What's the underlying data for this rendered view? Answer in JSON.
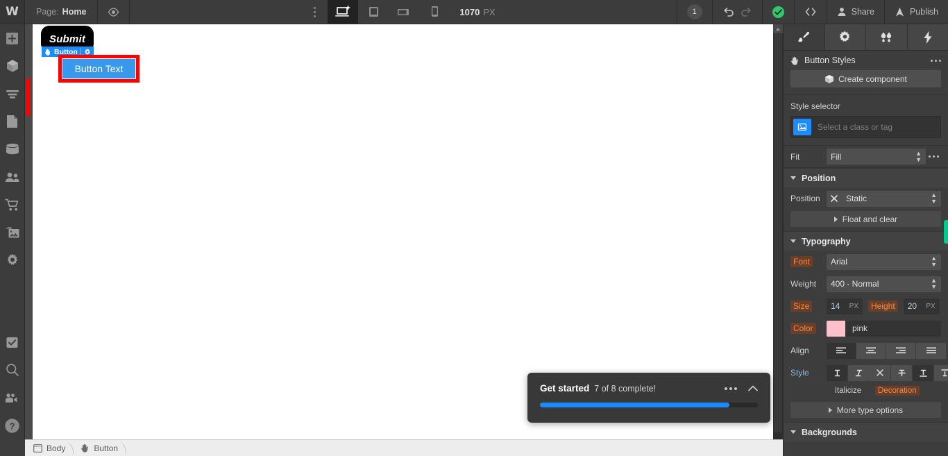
{
  "topbar": {
    "logo": "W",
    "page_label": "Page:",
    "page_name": "Home",
    "preview_icon": "eye-icon",
    "more_icon": "vertical-dots-icon",
    "breakpoints": [
      {
        "name": "desktop",
        "icon": "desktop-breakpoint-icon",
        "active": true
      },
      {
        "name": "tablet",
        "icon": "tablet-breakpoint-icon",
        "active": false
      },
      {
        "name": "mobile-landscape",
        "icon": "mobile-landscape-breakpoint-icon",
        "active": false
      },
      {
        "name": "mobile-portrait",
        "icon": "mobile-portrait-breakpoint-icon",
        "active": false
      }
    ],
    "viewport_width": "1070",
    "viewport_unit": "PX",
    "changes_count": "1",
    "undo_icon": "undo-icon",
    "redo_icon": "redo-icon",
    "saved_icon": "checkmark-icon",
    "code_icon": "code-brackets-icon",
    "share_label": "Share",
    "publish_label": "Publish"
  },
  "left_rail": {
    "items": [
      {
        "icon": "add-elements-icon",
        "name": "add-panel"
      },
      {
        "icon": "components-icon",
        "name": "components-panel"
      },
      {
        "icon": "navigator-icon",
        "name": "navigator-panel"
      },
      {
        "icon": "pages-icon",
        "name": "pages-panel"
      },
      {
        "icon": "cms-database-icon",
        "name": "cms-panel"
      },
      {
        "icon": "users-icon",
        "name": "users-panel"
      },
      {
        "icon": "ecommerce-cart-icon",
        "name": "ecommerce-panel"
      },
      {
        "icon": "assets-images-icon",
        "name": "assets-panel"
      },
      {
        "icon": "settings-gear-icon",
        "name": "settings-panel"
      }
    ],
    "bottom_items": [
      {
        "icon": "audit-checkbox-icon",
        "name": "audit-panel"
      },
      {
        "icon": "search-icon",
        "name": "search-panel"
      },
      {
        "icon": "video-camera-icon",
        "name": "video-tutorials"
      },
      {
        "icon": "help-question-icon",
        "name": "help-button"
      }
    ]
  },
  "canvas": {
    "submit_button_text": "Submit",
    "selected_label": "Button",
    "selected_label_hand_icon": "hand-cursor-icon",
    "selected_label_gear_icon": "gear-icon",
    "selected_button_text": "Button Text"
  },
  "get_started": {
    "title": "Get started",
    "subtitle": "7 of 8 complete!",
    "progress_percent": 87,
    "more_icon": "horizontal-dots-icon",
    "collapse_icon": "chevron-up-icon",
    "accent": "#1a8cff"
  },
  "right_panel": {
    "tabs": [
      {
        "name": "style-tab",
        "icon": "paintbrush-icon",
        "active": true
      },
      {
        "name": "settings-tab",
        "icon": "gear-icon",
        "active": false
      },
      {
        "name": "interactions-tab",
        "icon": "droplets-icon",
        "active": false
      },
      {
        "name": "effects-tab",
        "icon": "lightning-bolt-icon",
        "active": false
      }
    ],
    "header": {
      "icon": "hand-cursor-icon",
      "title": "Button Styles",
      "more_icon": "horizontal-dots-icon"
    },
    "create_component": {
      "label": "Create component",
      "icon": "component-cube-icon"
    },
    "style_selector": {
      "label": "Style selector",
      "badge_icon": "element-tag-icon",
      "placeholder": "Select a class or tag"
    },
    "fit": {
      "label": "Fit",
      "value": "Fill",
      "more_icon": "horizontal-dots-icon"
    },
    "position_section": {
      "title": "Position",
      "position_label": "Position",
      "position_clear_icon": "x-clear-icon",
      "position_value": "Static",
      "float_and_clear_label": "Float and clear"
    },
    "typography_section": {
      "title": "Typography",
      "font_label": "Font",
      "font_value": "Arial",
      "weight_label": "Weight",
      "weight_value": "400 - Normal",
      "size_label": "Size",
      "size_value": "14",
      "size_unit": "PX",
      "height_label": "Height",
      "height_value": "20",
      "height_unit": "PX",
      "color_label": "Color",
      "color_value": "pink",
      "color_swatch": "#ffc0cb",
      "align_label": "Align",
      "align_options": [
        {
          "name": "align-left",
          "icon": "align-left-icon",
          "active": true
        },
        {
          "name": "align-center",
          "icon": "align-center-icon",
          "active": false
        },
        {
          "name": "align-right",
          "icon": "align-right-icon",
          "active": false
        },
        {
          "name": "align-justify",
          "icon": "align-justify-icon",
          "active": false
        }
      ],
      "style_label": "Style",
      "italicize_label": "Italicize",
      "italicize_options": [
        {
          "name": "style-normal",
          "icon": "upright-text-icon",
          "active": true
        },
        {
          "name": "style-italic",
          "icon": "italic-text-icon",
          "active": false
        }
      ],
      "decoration_label": "Decoration",
      "decoration_options": [
        {
          "name": "decoration-none",
          "icon": "x-none-icon",
          "active": false
        },
        {
          "name": "decoration-strikethrough",
          "icon": "strikethrough-icon",
          "active": false
        },
        {
          "name": "decoration-underline",
          "icon": "underline-icon",
          "active": true
        },
        {
          "name": "decoration-overline",
          "icon": "overline-icon",
          "active": false
        }
      ],
      "more_type_options_label": "More type options"
    },
    "backgrounds_section": {
      "title": "Backgrounds"
    }
  },
  "breadcrumb": {
    "items": [
      {
        "label": "Body",
        "icon": "body-frame-icon"
      },
      {
        "label": "Button",
        "icon": "hand-cursor-icon"
      }
    ]
  }
}
